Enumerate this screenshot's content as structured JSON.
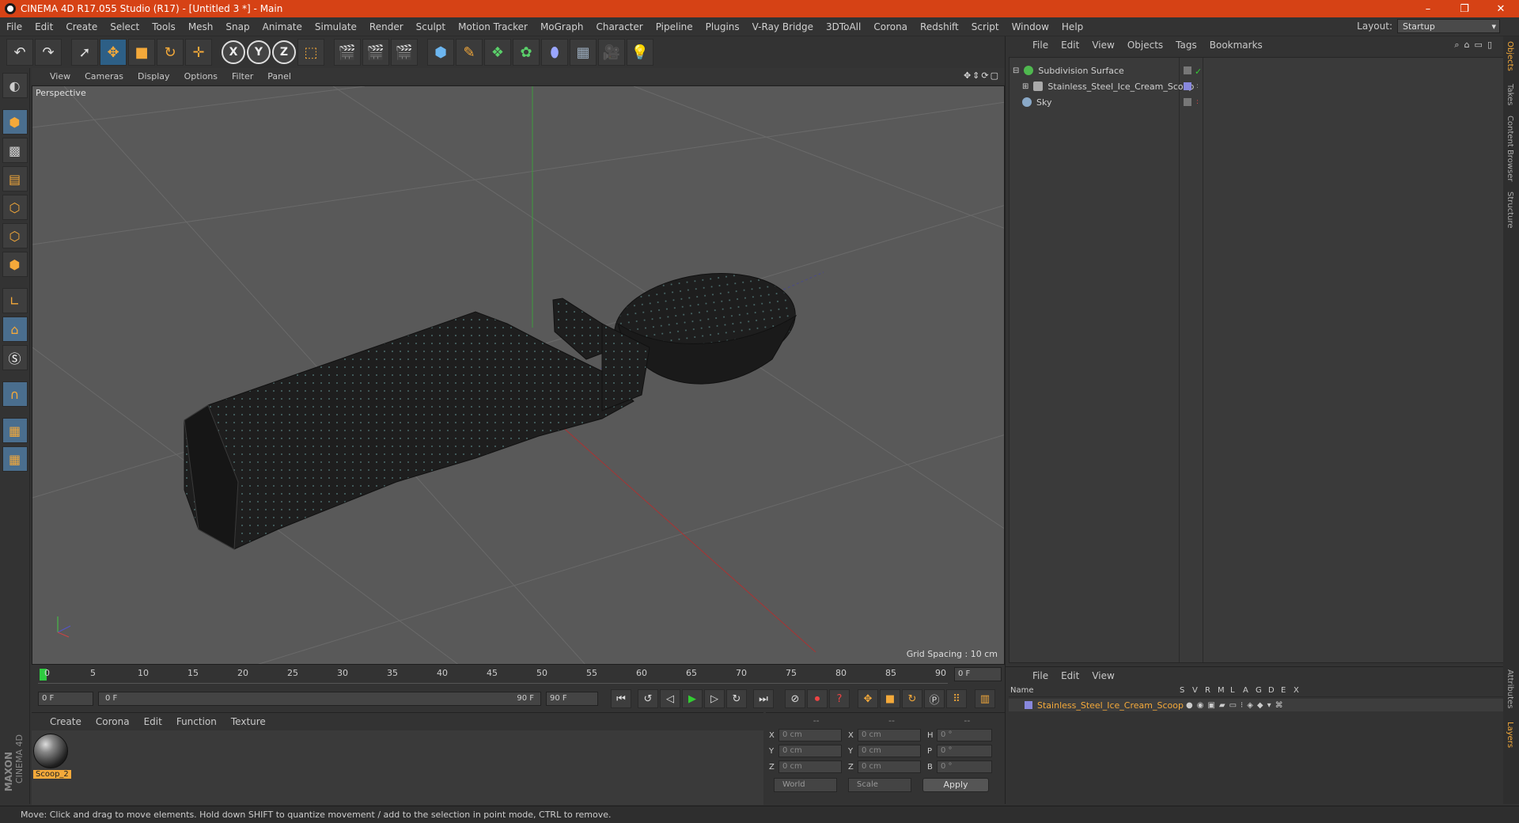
{
  "window": {
    "title": "CINEMA 4D R17.055 Studio (R17) - [Untitled 3 *] - Main",
    "controls": [
      "–",
      "❐",
      "✕"
    ]
  },
  "menu": {
    "items": [
      "File",
      "Edit",
      "Create",
      "Select",
      "Tools",
      "Mesh",
      "Snap",
      "Animate",
      "Simulate",
      "Render",
      "Sculpt",
      "Motion Tracker",
      "MoGraph",
      "Character",
      "Pipeline",
      "Plugins",
      "V-Ray Bridge",
      "3DToAll",
      "Corona",
      "Redshift",
      "Script",
      "Window",
      "Help"
    ],
    "layout_label": "Layout:",
    "layout_value": "Startup"
  },
  "toolbar": {
    "axis_x": "X",
    "axis_y": "Y",
    "axis_z": "Z"
  },
  "viewport": {
    "menu": [
      "View",
      "Cameras",
      "Display",
      "Options",
      "Filter",
      "Panel"
    ],
    "label": "Perspective",
    "grid_spacing": "Grid Spacing : 10 cm"
  },
  "timeline": {
    "ticks": [
      "0",
      "5",
      "10",
      "15",
      "20",
      "25",
      "30",
      "35",
      "40",
      "45",
      "50",
      "55",
      "60",
      "65",
      "70",
      "75",
      "80",
      "85",
      "90"
    ],
    "current_frame": "0 F"
  },
  "transport": {
    "start": "0 F",
    "range_start": "0 F",
    "range_end": "90 F",
    "end": "90 F"
  },
  "material_manager": {
    "menu": [
      "Create",
      "Corona",
      "Edit",
      "Function",
      "Texture"
    ],
    "material_name": "Scoop_2"
  },
  "coordinates": {
    "headers": [
      "--",
      "--",
      "--"
    ],
    "rows": [
      {
        "a": "X",
        "v1": "0 cm",
        "b": "X",
        "v2": "0 cm",
        "c": "H",
        "v3": "0 °"
      },
      {
        "a": "Y",
        "v1": "0 cm",
        "b": "Y",
        "v2": "0 cm",
        "c": "P",
        "v3": "0 °"
      },
      {
        "a": "Z",
        "v1": "0 cm",
        "b": "Z",
        "v2": "0 cm",
        "c": "B",
        "v3": "0 °"
      }
    ],
    "world": "World",
    "scale": "Scale",
    "apply": "Apply"
  },
  "object_manager": {
    "menu": [
      "File",
      "Edit",
      "View",
      "Objects",
      "Tags",
      "Bookmarks"
    ],
    "objects": [
      {
        "name": "Subdivision Surface",
        "icon_color": "#4fb84f"
      },
      {
        "name": "Stainless_Steel_Ice_Cream_Scoop",
        "icon_color": "#aaaaaa"
      },
      {
        "name": "Sky",
        "icon_color": "#8aa9c8"
      }
    ]
  },
  "layer_manager": {
    "menu": [
      "File",
      "Edit",
      "View"
    ],
    "columns": [
      "Name",
      "S",
      "V",
      "R",
      "M",
      "L",
      "A",
      "G",
      "D",
      "E",
      "X"
    ],
    "layer_name": "Stainless_Steel_Ice_Cream_Scoop",
    "layer_color": "#8888dd"
  },
  "side_tabs": [
    "Objects",
    "Takes",
    "Content Browser",
    "Structure",
    "Attributes",
    "Layers"
  ],
  "status": "Move: Click and drag to move elements. Hold down SHIFT to quantize movement / add to the selection in point mode, CTRL to remove.",
  "logo": {
    "line1": "MAXON",
    "line2": "CINEMA 4D"
  },
  "colors": {
    "titlebar": "#d64215",
    "accent": "#f4a93a",
    "selection": "#2d5f86"
  }
}
